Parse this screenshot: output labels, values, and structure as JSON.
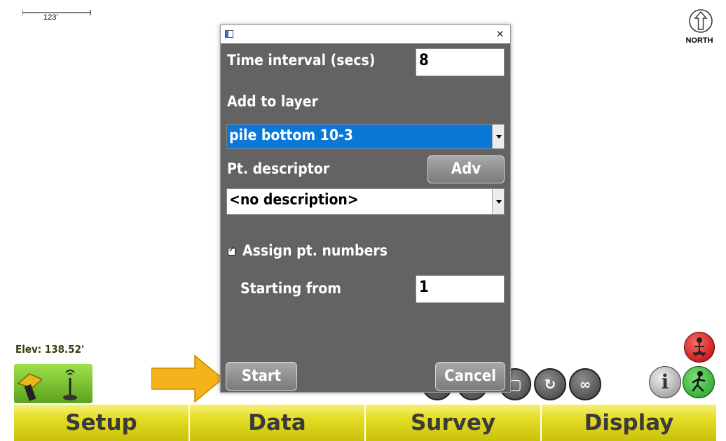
{
  "map": {
    "scale_label": "123'",
    "north_label": "NORTH",
    "elevation": "Elev: 138.52'"
  },
  "dialog": {
    "time_interval_label": "Time interval (secs)",
    "time_interval_value": "8",
    "add_to_layer_label": "Add to layer",
    "layer_value": "pile bottom 10-3",
    "pt_descriptor_label": "Pt. descriptor",
    "adv_button": "Adv",
    "descriptor_value": "<no description>",
    "assign_pt_numbers_label": "Assign pt. numbers",
    "assign_pt_numbers_checked": true,
    "starting_from_label": "Starting from",
    "starting_from_value": "1",
    "start_button": "Start",
    "cancel_button": "Cancel",
    "close_symbol": "×"
  },
  "bottom_nav": [
    {
      "label": "Setup"
    },
    {
      "label": "Data"
    },
    {
      "label": "Survey"
    },
    {
      "label": "Display"
    }
  ],
  "colors": {
    "dialog_bg": "#636363",
    "selection_blue": "#0a78d7",
    "nav_yellow": "#e6df27",
    "arrow_orange": "#f5b21b"
  }
}
